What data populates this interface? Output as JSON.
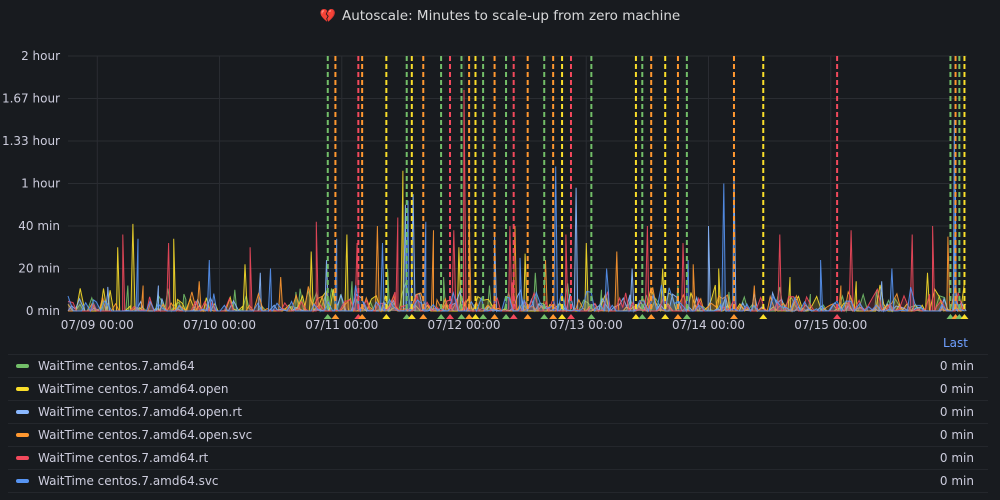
{
  "panel": {
    "title": "Autoscale: Minutes to scale-up from zero machine",
    "icon": "broken-heart-icon",
    "icon_color": "#e3778f"
  },
  "legend": {
    "header_last": "Last",
    "items": [
      {
        "name": "WaitTime centos.7.amd64",
        "color": "#73bf69",
        "last": "0 min"
      },
      {
        "name": "WaitTime centos.7.amd64.open",
        "color": "#fade2a",
        "last": "0 min"
      },
      {
        "name": "WaitTime centos.7.amd64.open.rt",
        "color": "#8ab8ff",
        "last": "0 min"
      },
      {
        "name": "WaitTime centos.7.amd64.open.svc",
        "color": "#ff9830",
        "last": "0 min"
      },
      {
        "name": "WaitTime centos.7.amd64.rt",
        "color": "#f2495c",
        "last": "0 min"
      },
      {
        "name": "WaitTime centos.7.amd64.svc",
        "color": "#5794f2",
        "last": "0 min"
      }
    ]
  },
  "chart_data": {
    "type": "line",
    "title": "Autoscale: Minutes to scale-up from zero machine",
    "ylim": [
      0,
      120
    ],
    "y_ticks": [
      {
        "value": 0,
        "label": "0 min"
      },
      {
        "value": 20,
        "label": "20 min"
      },
      {
        "value": 40,
        "label": "40 min"
      },
      {
        "value": 60,
        "label": "1 hour"
      },
      {
        "value": 80,
        "label": "1.33 hour"
      },
      {
        "value": 100,
        "label": "1.67 hour"
      },
      {
        "value": 120,
        "label": "2 hour"
      }
    ],
    "xlim": [
      "07/08 18:15",
      "07/16 02:45"
    ],
    "x_ticks": [
      "07/09 00:00",
      "07/10 00:00",
      "07/11 00:00",
      "07/12 00:00",
      "07/13 00:00",
      "07/14 00:00",
      "07/15 00:00"
    ],
    "grid": true,
    "series": [
      {
        "name": "WaitTime centos.7.amd64",
        "color": "#73bf69",
        "peaks": [
          [
            "07/09 01:00",
            6
          ],
          [
            "07/09 06:00",
            12
          ],
          [
            "07/09 17:00",
            8
          ],
          [
            "07/10 03:00",
            10
          ],
          [
            "07/10 15:00",
            9
          ],
          [
            "07/11 02:00",
            14
          ],
          [
            "07/11 09:00",
            20
          ],
          [
            "07/11 20:00",
            16
          ],
          [
            "07/12 05:00",
            12
          ],
          [
            "07/12 14:00",
            18
          ],
          [
            "07/13 03:00",
            10
          ],
          [
            "07/13 18:00",
            12
          ],
          [
            "07/14 04:00",
            9
          ],
          [
            "07/14 20:00",
            8
          ],
          [
            "07/15 09:00",
            10
          ],
          [
            "07/16 00:00",
            8
          ]
        ]
      },
      {
        "name": "WaitTime centos.7.amd64.open",
        "color": "#fade2a",
        "peaks": [
          [
            "07/09 04:00",
            30
          ],
          [
            "07/09 07:00",
            41
          ],
          [
            "07/09 15:00",
            34
          ],
          [
            "07/10 05:00",
            22
          ],
          [
            "07/10 18:00",
            28
          ],
          [
            "07/11 01:00",
            36
          ],
          [
            "07/11 12:00",
            66
          ],
          [
            "07/11 23:00",
            30
          ],
          [
            "07/12 12:00",
            27
          ],
          [
            "07/13 00:00",
            32
          ],
          [
            "07/13 15:00",
            20
          ],
          [
            "07/14 02:00",
            20
          ],
          [
            "07/14 16:00",
            16
          ],
          [
            "07/15 05:00",
            14
          ],
          [
            "07/15 19:00",
            18
          ]
        ]
      },
      {
        "name": "WaitTime centos.7.amd64.open.rt",
        "color": "#8ab8ff",
        "peaks": [
          [
            "07/09 02:00",
            8
          ],
          [
            "07/09 12:00",
            12
          ],
          [
            "07/10 08:00",
            18
          ],
          [
            "07/10 21:00",
            24
          ],
          [
            "07/11 12:30",
            50
          ],
          [
            "07/11 14:00",
            55
          ],
          [
            "07/12 06:00",
            36
          ],
          [
            "07/12 22:00",
            58
          ],
          [
            "07/13 09:00",
            20
          ],
          [
            "07/14 00:00",
            40
          ],
          [
            "07/14 05:00",
            62
          ],
          [
            "07/15 10:00",
            14
          ],
          [
            "07/16 00:30",
            57
          ]
        ]
      },
      {
        "name": "WaitTime centos.7.amd64.open.svc",
        "color": "#ff9830",
        "peaks": [
          [
            "07/09 09:00",
            12
          ],
          [
            "07/09 20:00",
            14
          ],
          [
            "07/10 12:00",
            16
          ],
          [
            "07/11 07:00",
            40
          ],
          [
            "07/11 18:00",
            38
          ],
          [
            "07/12 01:00",
            46
          ],
          [
            "07/12 10:00",
            40
          ],
          [
            "07/12 16:00",
            24
          ],
          [
            "07/13 06:00",
            28
          ],
          [
            "07/13 21:00",
            22
          ],
          [
            "07/14 09:00",
            12
          ],
          [
            "07/15 02:00",
            12
          ],
          [
            "07/15 23:00",
            35
          ]
        ]
      },
      {
        "name": "WaitTime centos.7.amd64.rt",
        "color": "#f2495c",
        "peaks": [
          [
            "07/09 05:00",
            36
          ],
          [
            "07/09 14:00",
            32
          ],
          [
            "07/10 06:00",
            30
          ],
          [
            "07/10 19:00",
            42
          ],
          [
            "07/11 03:00",
            32
          ],
          [
            "07/11 11:00",
            44
          ],
          [
            "07/11 22:00",
            38
          ],
          [
            "07/12 00:00",
            104
          ],
          [
            "07/12 09:00",
            40
          ],
          [
            "07/12 20:00",
            36
          ],
          [
            "07/13 12:00",
            40
          ],
          [
            "07/13 19:00",
            32
          ],
          [
            "07/14 14:00",
            36
          ],
          [
            "07/15 04:00",
            38
          ],
          [
            "07/15 16:00",
            36
          ],
          [
            "07/15 20:00",
            40
          ]
        ]
      },
      {
        "name": "WaitTime centos.7.amd64.svc",
        "color": "#5794f2",
        "peaks": [
          [
            "07/09 08:00",
            34
          ],
          [
            "07/09 22:00",
            24
          ],
          [
            "07/10 10:00",
            20
          ],
          [
            "07/10 23:00",
            34
          ],
          [
            "07/11 08:00",
            32
          ],
          [
            "07/11 13:00",
            52
          ],
          [
            "07/11 16:30",
            42
          ],
          [
            "07/12 11:00",
            25
          ],
          [
            "07/12 18:00",
            68
          ],
          [
            "07/13 04:00",
            20
          ],
          [
            "07/13 20:00",
            24
          ],
          [
            "07/14 03:00",
            60
          ],
          [
            "07/14 22:00",
            24
          ],
          [
            "07/15 12:00",
            20
          ],
          [
            "07/16 00:15",
            90
          ]
        ]
      }
    ],
    "annotations": [
      {
        "time": "07/10 21:15",
        "color": "#73bf69"
      },
      {
        "time": "07/10 22:45",
        "color": "#ff9830"
      },
      {
        "time": "07/11 03:15",
        "color": "#f2495c"
      },
      {
        "time": "07/11 04:00",
        "color": "#ff9830"
      },
      {
        "time": "07/11 08:45",
        "color": "#fade2a"
      },
      {
        "time": "07/11 12:45",
        "color": "#73bf69"
      },
      {
        "time": "07/11 13:45",
        "color": "#fade2a"
      },
      {
        "time": "07/11 16:00",
        "color": "#ff9830"
      },
      {
        "time": "07/11 19:30",
        "color": "#73bf69"
      },
      {
        "time": "07/11 21:15",
        "color": "#f2495c"
      },
      {
        "time": "07/11 23:30",
        "color": "#73bf69"
      },
      {
        "time": "07/12 01:00",
        "color": "#ff9830"
      },
      {
        "time": "07/12 02:15",
        "color": "#fade2a"
      },
      {
        "time": "07/12 03:45",
        "color": "#73bf69"
      },
      {
        "time": "07/12 06:00",
        "color": "#ff9830"
      },
      {
        "time": "07/12 08:15",
        "color": "#73bf69"
      },
      {
        "time": "07/12 09:45",
        "color": "#f2495c"
      },
      {
        "time": "07/12 12:30",
        "color": "#ff9830"
      },
      {
        "time": "07/12 15:45",
        "color": "#73bf69"
      },
      {
        "time": "07/12 17:30",
        "color": "#ff9830"
      },
      {
        "time": "07/12 19:15",
        "color": "#fade2a"
      },
      {
        "time": "07/12 21:00",
        "color": "#f2495c"
      },
      {
        "time": "07/13 01:00",
        "color": "#73bf69"
      },
      {
        "time": "07/13 09:45",
        "color": "#fade2a"
      },
      {
        "time": "07/13 11:00",
        "color": "#73bf69"
      },
      {
        "time": "07/13 12:45",
        "color": "#ff9830"
      },
      {
        "time": "07/13 15:30",
        "color": "#fade2a"
      },
      {
        "time": "07/13 18:00",
        "color": "#ff9830"
      },
      {
        "time": "07/13 19:45",
        "color": "#73bf69"
      },
      {
        "time": "07/14 05:00",
        "color": "#ff9830"
      },
      {
        "time": "07/14 10:45",
        "color": "#fade2a"
      },
      {
        "time": "07/15 01:15",
        "color": "#f2495c"
      },
      {
        "time": "07/15 23:30",
        "color": "#73bf69"
      },
      {
        "time": "07/16 00:30",
        "color": "#ff9830"
      },
      {
        "time": "07/16 01:15",
        "color": "#73bf69"
      },
      {
        "time": "07/16 02:15",
        "color": "#fade2a"
      }
    ]
  }
}
